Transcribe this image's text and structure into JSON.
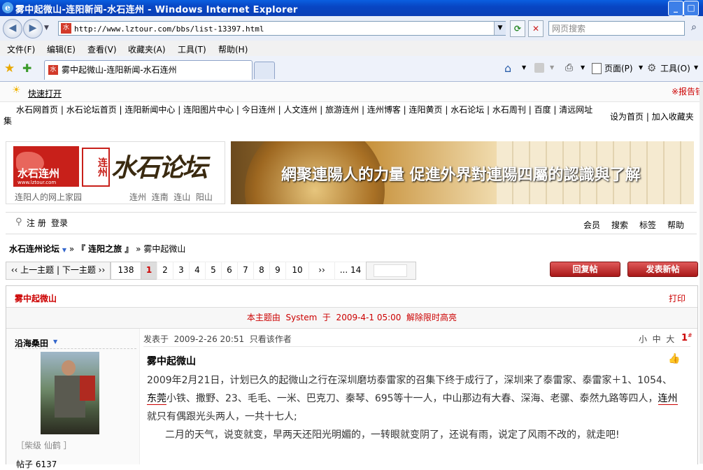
{
  "window": {
    "title": "雾中起微山-连阳新闻-水石连州 - Windows Internet Explorer",
    "minimize": "_",
    "maximize": "□",
    "close": "✕"
  },
  "address": {
    "url": "http://www.lztour.com/bbs/list-13397.html",
    "search_placeholder": "网页搜索"
  },
  "menu": [
    "文件(F)",
    "编辑(E)",
    "查看(V)",
    "收藏夹(A)",
    "工具(T)",
    "帮助(H)"
  ],
  "tabs": {
    "active": "雾中起微山-连阳新闻-水石连州",
    "right": {
      "page": "页面(P)",
      "tools": "工具(O)"
    }
  },
  "quickbar": {
    "quick_open": "快速打开",
    "report": "※报告错"
  },
  "site_nav": {
    "links": [
      "水石网首页",
      "水石论坛首页",
      "连阳新闻中心",
      "连阳图片中心",
      "今日连州",
      "人文连州",
      "旅游连州",
      "连州博客",
      "连阳黄页",
      "水石论坛",
      "水石周刊",
      "百度",
      "清远网址"
    ],
    "wrap": "集",
    "set_home": "设为首页",
    "add_fav": "加入收藏夹"
  },
  "logo": {
    "brand": "水石连州",
    "domain": "www.lztour.com",
    "calligraphy": "水石论坛",
    "seal": "连州",
    "slogan": "连阳人的网上家园",
    "towns": "连州  连南  连山  阳山"
  },
  "ad_banner": {
    "text": "網聚連陽人的力量 促進外界對連陽四屬的認識與了解"
  },
  "userbar": {
    "register": "注 册",
    "login": "登录",
    "links": [
      "会员",
      "搜索",
      "标签",
      "帮助"
    ]
  },
  "breadcrumb": {
    "forum": "水石连州论坛",
    "section": "『 连阳之旅 』",
    "current": "雾中起微山"
  },
  "pager": {
    "prev_next": "‹‹ 上一主题 | 下一主题 ››",
    "total": "138",
    "pages": [
      "1",
      "2",
      "3",
      "4",
      "5",
      "6",
      "7",
      "8",
      "9",
      "10"
    ],
    "current": "1",
    "next": "››",
    "last": "... 14"
  },
  "buttons": {
    "reply": "回复帖",
    "new_post": "发表新帖"
  },
  "thread": {
    "title": "雾中起微山",
    "print": "打印",
    "highlight_notice": "本主题由  System  于  2009-4-1 05:00  解除限时高亮"
  },
  "post": {
    "author": "沿海桑田",
    "author_group": "［柴级  仙鹤 ］",
    "author_posts": "帖子 6137",
    "meta": "发表于  2009-2-26 20:51  只看该作者",
    "font_sizes": "小  中  大",
    "floor": "1",
    "floor_mark": "#",
    "title": "雾中起微山",
    "body_1": "2009年2月21日，计划已久的起微山之行在深圳磨坊泰雷家的召集下终于成行了，深圳来了泰雷家、泰雷家＋1、1054、",
    "body_link1": "东莞",
    "body_2": "小铁、撒野、23、毛毛、一米、巴克刀、秦琴、695等十一人，中山那边有大春、深海、老骡、泰然九路等四人，",
    "body_link2": "连州",
    "body_3": "就只有偶跟光头两人，一共十七人;",
    "body_para2": "二月的天气，说变就变，早两天还阳光明媚的，一转眼就变阴了，还说有雨，说定了风雨不改的，就走吧!"
  }
}
